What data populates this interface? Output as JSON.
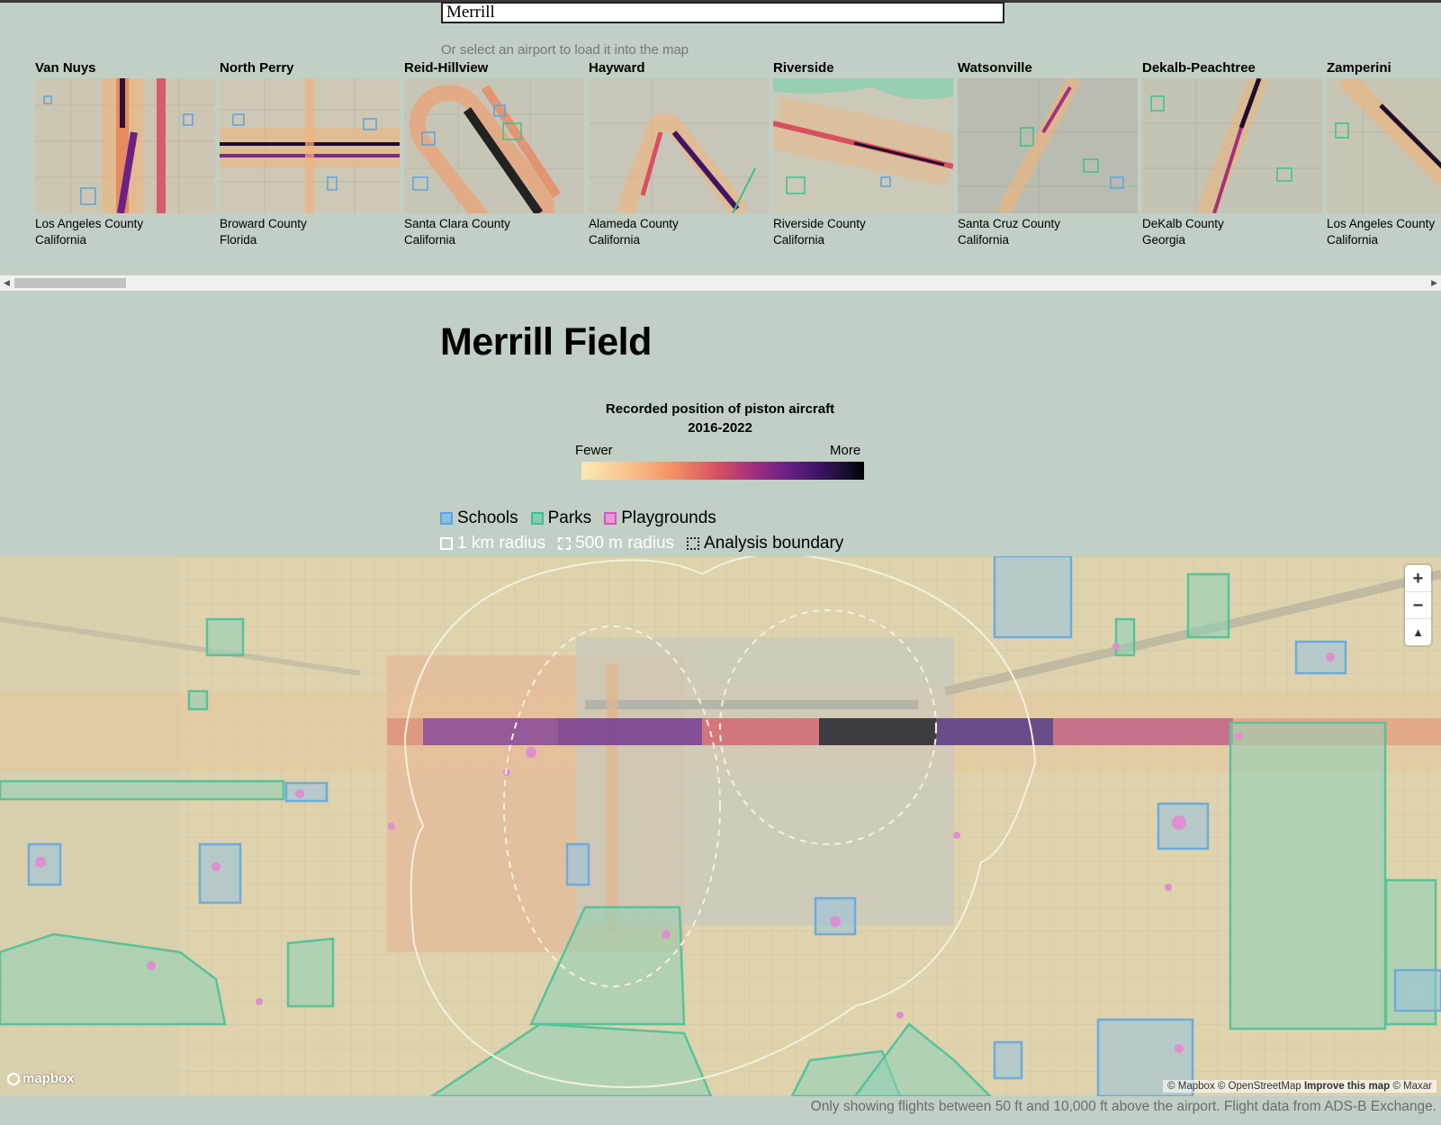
{
  "search": {
    "value": "Merrill"
  },
  "hint": "Or select an airport to load it into the map",
  "airports": [
    {
      "name": "Van Nuys",
      "county": "Los Angeles County",
      "state": "California"
    },
    {
      "name": "North Perry",
      "county": "Broward County",
      "state": "Florida"
    },
    {
      "name": "Reid-Hillview",
      "county": "Santa Clara County",
      "state": "California"
    },
    {
      "name": "Hayward",
      "county": "Alameda County",
      "state": "California"
    },
    {
      "name": "Riverside",
      "county": "Riverside County",
      "state": "California"
    },
    {
      "name": "Watsonville",
      "county": "Santa Cruz County",
      "state": "California"
    },
    {
      "name": "Dekalb-Peachtree",
      "county": "DeKalb County",
      "state": "Georgia"
    },
    {
      "name": "Zamperini",
      "county": "Los Angeles County",
      "state": "California"
    }
  ],
  "title": "Merrill Field",
  "legend": {
    "title_line1": "Recorded position of piston aircraft",
    "title_line2": "2016-2022",
    "low": "Fewer",
    "high": "More",
    "ramp_colors": [
      "#fbe9b4",
      "#f49264",
      "#d85062",
      "#a5307c",
      "#6d2187",
      "#3e1466",
      "#000000"
    ],
    "schools": "Schools",
    "parks": "Parks",
    "playgrounds": "Playgrounds",
    "radius_1km": "1 km radius",
    "radius_500m": "500 m radius",
    "boundary": "Analysis boundary"
  },
  "layer_colors": {
    "schools": "#5aa3dd",
    "parks": "#3fbf8f",
    "playgrounds": "#cf59bd"
  },
  "map": {
    "zoom_in": "+",
    "zoom_out": "−",
    "compass": "▲",
    "logo": "mapbox",
    "attribution_1": "© Mapbox © OpenStreetMap",
    "improve": "Improve this map",
    "attribution_2": "© Maxar"
  },
  "footnote": "Only showing flights between 50 ft and 10,000 ft above the airport. Flight data from ADS-B Exchange."
}
